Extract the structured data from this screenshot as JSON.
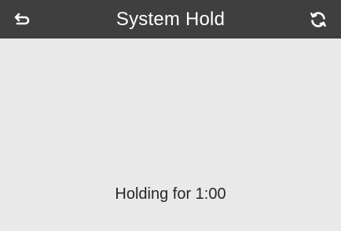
{
  "header": {
    "title": "System Hold",
    "back_icon": "back-arrow-icon",
    "refresh_icon": "refresh-icon"
  },
  "main": {
    "status_text": "Holding for 1:00"
  },
  "colors": {
    "header_bg": "#3f3f3f",
    "header_text": "#ffffff",
    "content_bg": "#e9e9e9",
    "body_text": "#262626"
  }
}
